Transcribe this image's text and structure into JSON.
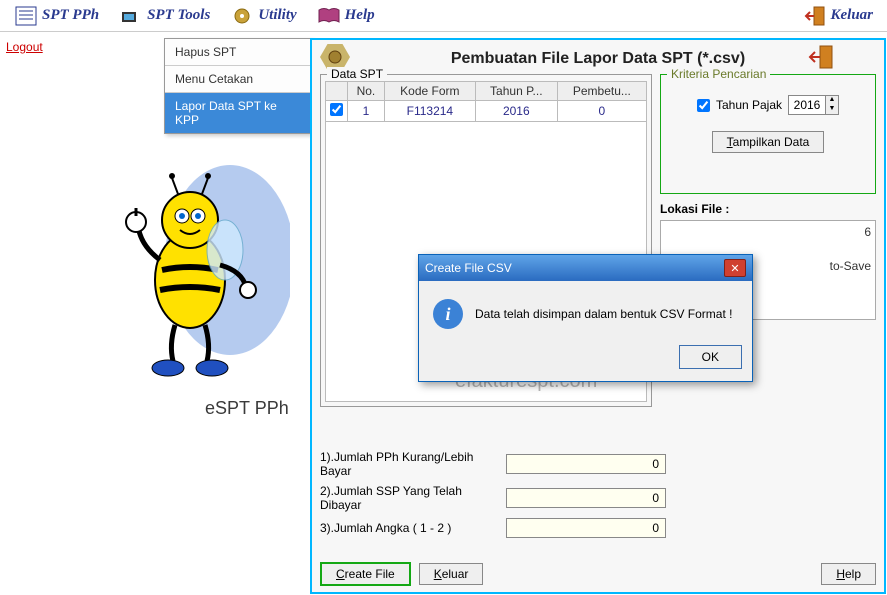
{
  "menubar": {
    "items": [
      {
        "label": "SPT PPh"
      },
      {
        "label": "SPT Tools"
      },
      {
        "label": "Utility"
      },
      {
        "label": "Help"
      },
      {
        "label": "Keluar"
      }
    ]
  },
  "logout_label": "Logout",
  "dropdown": {
    "items": [
      {
        "label": "Hapus SPT"
      },
      {
        "label": "Menu Cetakan"
      },
      {
        "label": "Lapor Data SPT ke KPP",
        "selected": true
      }
    ]
  },
  "app_title": "eSPT PPh",
  "watermark": "efakturespt.com",
  "panel": {
    "title": "Pembuatan File Lapor Data SPT (*.csv)",
    "data_spt_legend": "Data SPT",
    "columns": [
      "No.",
      "Kode Form",
      "Tahun P...",
      "Pembetu..."
    ],
    "rows": [
      {
        "checked": true,
        "no": "1",
        "kode": "F113214",
        "tahun": "2016",
        "pembetulan": "0"
      }
    ],
    "kriteria": {
      "legend": "Kriteria Pencarian",
      "tahun_label": "Tahun Pajak",
      "tahun_value": "2016",
      "tampilkan_label": "Tampilkan Data"
    },
    "lokasi": {
      "label": "Lokasi File :",
      "lines": [
        "6",
        "to-Save"
      ]
    },
    "bottom": [
      {
        "label": "1).Jumlah PPh Kurang/Lebih Bayar",
        "value": "0"
      },
      {
        "label": "2).Jumlah SSP Yang Telah Dibayar",
        "value": "0"
      },
      {
        "label": "3).Jumlah Angka ( 1 - 2 )",
        "value": "0"
      }
    ],
    "buttons": {
      "create": "Create File",
      "keluar": "Keluar",
      "help": "Help"
    }
  },
  "dialog": {
    "title": "Create File CSV",
    "message": "Data telah disimpan dalam bentuk CSV Format !",
    "ok": "OK"
  }
}
